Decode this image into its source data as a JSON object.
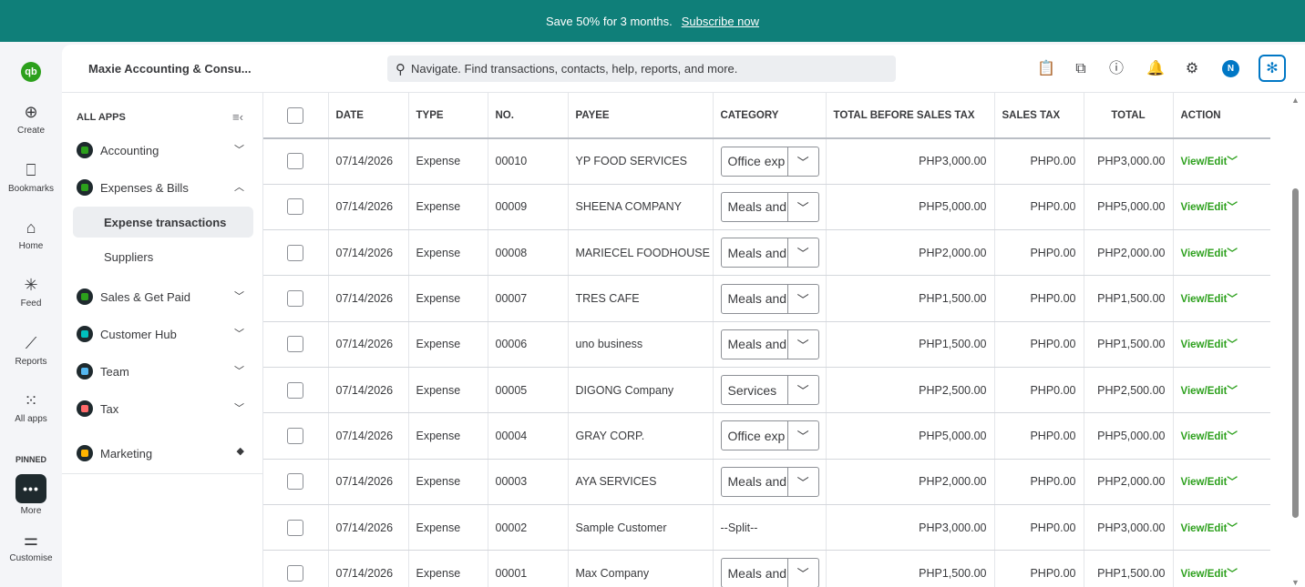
{
  "banner": {
    "text": "Save 50% for 3 months.",
    "link": "Subscribe now"
  },
  "rail": {
    "logo": "qb",
    "items": [
      {
        "label": "Create",
        "icon": "plus-circle-icon",
        "glyph": "⊕"
      },
      {
        "label": "Bookmarks",
        "icon": "bookmark-icon",
        "glyph": "⎕"
      },
      {
        "label": "Home",
        "icon": "home-icon",
        "glyph": "⌂"
      },
      {
        "label": "Feed",
        "icon": "feed-icon",
        "glyph": "✳"
      },
      {
        "label": "Reports",
        "icon": "reports-icon",
        "glyph": "⟋"
      },
      {
        "label": "All apps",
        "icon": "grid-icon",
        "glyph": "⁙"
      }
    ],
    "pinned": "PINNED",
    "more": "More",
    "customise": "Customise"
  },
  "topbar": {
    "company": "Maxie Accounting & Consu...",
    "search_placeholder": "Navigate. Find transactions, contacts, help, reports, and more.",
    "avatar": "N"
  },
  "sidenav": {
    "header": "ALL APPS",
    "items": [
      {
        "label": "Accounting",
        "color": "#2ca01c",
        "expanded": false
      },
      {
        "label": "Expenses & Bills",
        "color": "#2ca01c",
        "expanded": true
      },
      {
        "label": "Sales & Get Paid",
        "color": "#2ca01c",
        "expanded": false
      },
      {
        "label": "Customer Hub",
        "color": "#00c1bf",
        "expanded": false
      },
      {
        "label": "Team",
        "color": "#54b7f0",
        "expanded": false
      },
      {
        "label": "Tax",
        "color": "#ff6a6a",
        "expanded": false
      },
      {
        "label": "Marketing",
        "color": "#ffb400",
        "expanded": false
      }
    ],
    "sub_items": [
      "Expense transactions",
      "Suppliers"
    ]
  },
  "table": {
    "columns": [
      "DATE",
      "TYPE",
      "NO.",
      "PAYEE",
      "CATEGORY",
      "TOTAL BEFORE SALES TAX",
      "SALES TAX",
      "TOTAL",
      "ACTION"
    ],
    "action_label": "View/Edit",
    "rows": [
      {
        "date": "07/14/2026",
        "type": "Expense",
        "no": "00010",
        "payee": "YP FOOD SERVICES",
        "category": "Office exp",
        "select": true,
        "before_tax": "PHP3,000.00",
        "tax": "PHP0.00",
        "total": "PHP3,000.00"
      },
      {
        "date": "07/14/2026",
        "type": "Expense",
        "no": "00009",
        "payee": "SHEENA COMPANY",
        "category": "Meals and",
        "select": true,
        "before_tax": "PHP5,000.00",
        "tax": "PHP0.00",
        "total": "PHP5,000.00"
      },
      {
        "date": "07/14/2026",
        "type": "Expense",
        "no": "00008",
        "payee": "MARIECEL FOODHOUSE",
        "category": "Meals and",
        "select": true,
        "before_tax": "PHP2,000.00",
        "tax": "PHP0.00",
        "total": "PHP2,000.00"
      },
      {
        "date": "07/14/2026",
        "type": "Expense",
        "no": "00007",
        "payee": "TRES CAFE",
        "category": "Meals and",
        "select": true,
        "before_tax": "PHP1,500.00",
        "tax": "PHP0.00",
        "total": "PHP1,500.00"
      },
      {
        "date": "07/14/2026",
        "type": "Expense",
        "no": "00006",
        "payee": "uno business",
        "category": "Meals and",
        "select": true,
        "before_tax": "PHP1,500.00",
        "tax": "PHP0.00",
        "total": "PHP1,500.00"
      },
      {
        "date": "07/14/2026",
        "type": "Expense",
        "no": "00005",
        "payee": "DIGONG Company",
        "category": "Services",
        "select": true,
        "before_tax": "PHP2,500.00",
        "tax": "PHP0.00",
        "total": "PHP2,500.00"
      },
      {
        "date": "07/14/2026",
        "type": "Expense",
        "no": "00004",
        "payee": "GRAY CORP.",
        "category": "Office exp",
        "select": true,
        "before_tax": "PHP5,000.00",
        "tax": "PHP0.00",
        "total": "PHP5,000.00"
      },
      {
        "date": "07/14/2026",
        "type": "Expense",
        "no": "00003",
        "payee": "AYA SERVICES",
        "category": "Meals and",
        "select": true,
        "before_tax": "PHP2,000.00",
        "tax": "PHP0.00",
        "total": "PHP2,000.00"
      },
      {
        "date": "07/14/2026",
        "type": "Expense",
        "no": "00002",
        "payee": "Sample Customer",
        "category": "--Split--",
        "select": false,
        "before_tax": "PHP3,000.00",
        "tax": "PHP0.00",
        "total": "PHP3,000.00"
      },
      {
        "date": "07/14/2026",
        "type": "Expense",
        "no": "00001",
        "payee": "Max Company",
        "category": "Meals and",
        "select": true,
        "before_tax": "PHP1,500.00",
        "tax": "PHP0.00",
        "total": "PHP1,500.00"
      }
    ]
  }
}
